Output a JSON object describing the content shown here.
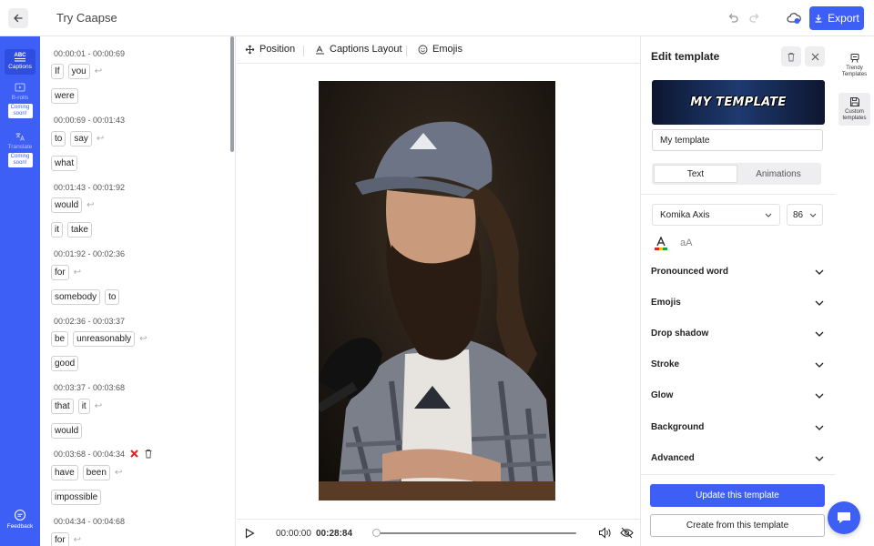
{
  "header": {
    "title": "Try Caapse",
    "export_label": "Export"
  },
  "leftnav": {
    "items": [
      {
        "label": "Captions",
        "icon": "abc-captions-icon",
        "active": true
      },
      {
        "label": "B-rolls",
        "icon": "b-roll-icon",
        "badge": "Coming soon!"
      },
      {
        "label": "Translate",
        "icon": "translate-icon",
        "badge": "Coming soon!"
      }
    ],
    "feedback_label": "Feedback"
  },
  "transcript": {
    "segments": [
      {
        "time": "00:00:01 - 00:00:69",
        "lines": [
          [
            "If",
            "you"
          ],
          [
            "were"
          ]
        ]
      },
      {
        "time": "00:00:69 - 00:01:43",
        "lines": [
          [
            "to",
            "say"
          ],
          [
            "what"
          ]
        ]
      },
      {
        "time": "00:01:43 - 00:01:92",
        "lines": [
          [
            "would"
          ],
          [
            "it",
            "take"
          ]
        ]
      },
      {
        "time": "00:01:92 - 00:02:36",
        "lines": [
          [
            "for"
          ],
          [
            "somebody",
            "to"
          ]
        ]
      },
      {
        "time": "00:02:36 - 00:03:37",
        "lines": [
          [
            "be",
            "unreasonably"
          ],
          [
            "good"
          ]
        ]
      },
      {
        "time": "00:03:37 - 00:03:68",
        "lines": [
          [
            "that",
            "it"
          ],
          [
            "would"
          ]
        ]
      },
      {
        "time": "00:03:68 - 00:04:34",
        "lines": [
          [
            "have",
            "been"
          ],
          [
            "impossible"
          ]
        ]
      },
      {
        "time": "00:04:34 - 00:04:68",
        "lines": [
          [
            "for"
          ]
        ]
      }
    ]
  },
  "toolbar": {
    "position_label": "Position",
    "captions_layout_label": "Captions Layout",
    "emojis_label": "Emojis"
  },
  "player": {
    "current_time": "00:00:00",
    "duration": "00:28:84",
    "progress": 0
  },
  "edit_panel": {
    "title": "Edit template",
    "preview_text": "MY TEMPLATE",
    "template_name": "My template",
    "tabs": [
      "Text",
      "Animations"
    ],
    "active_tab": "Text",
    "font": "Komika Axis",
    "font_size": "86",
    "case_icon_text": "aA",
    "sections": [
      "Pronounced word",
      "Emojis",
      "Drop shadow",
      "Stroke",
      "Glow",
      "Background",
      "Advanced"
    ],
    "update_label": "Update this template",
    "create_label": "Create from this template"
  },
  "right_panel": {
    "items": [
      {
        "label": "Trendy Templates",
        "icon": "trendy-templates-icon"
      },
      {
        "label": "Custom templates",
        "icon": "save-icon",
        "active": true
      }
    ]
  },
  "colors": {
    "accent": "#3d5ff5",
    "nav_bg": "#3d5ff5",
    "delete_red": "#e02424"
  }
}
